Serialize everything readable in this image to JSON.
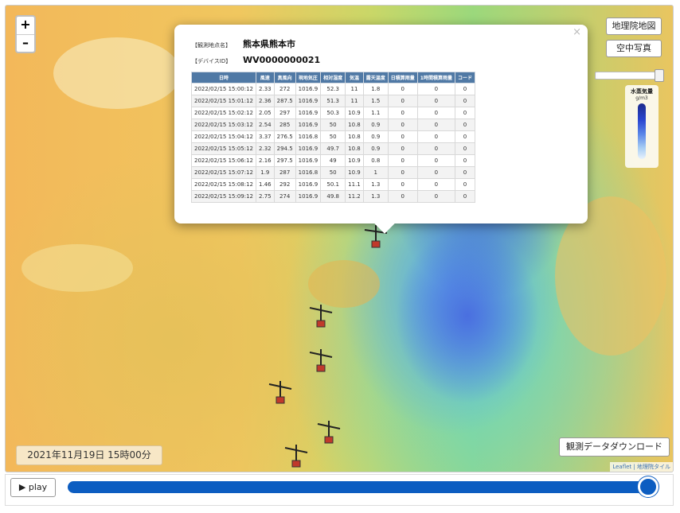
{
  "map": {
    "zoom_in": "+",
    "zoom_out": "–",
    "layer_buttons": {
      "gsi_map": "地理院地図",
      "aerial": "空中写真"
    },
    "legend": {
      "title": "水蒸気量",
      "unit": "g/m3"
    },
    "time_display": "2021年11月19日 15時00分",
    "download_label": "観測データダウンロード",
    "attribution": "Leaflet | 地理院タイル"
  },
  "popup": {
    "close": "×",
    "location_label": "【観測地点名】",
    "location_value": "熊本県熊本市",
    "device_label": "【デバイスID】",
    "device_value": "WV0000000021",
    "headers": [
      "日時",
      "風速",
      "真風向",
      "現地気圧",
      "相対湿度",
      "気温",
      "露天温度",
      "日積算雨量",
      "1時間積算雨量",
      "コード"
    ],
    "rows": [
      [
        "2022/02/15 15:00:12",
        "2.33",
        "272",
        "1016.9",
        "52.3",
        "11",
        "1.8",
        "0",
        "0",
        "0"
      ],
      [
        "2022/02/15 15:01:12",
        "2.36",
        "287.5",
        "1016.9",
        "51.3",
        "11",
        "1.5",
        "0",
        "0",
        "0"
      ],
      [
        "2022/02/15 15:02:12",
        "2.05",
        "297",
        "1016.9",
        "50.3",
        "10.9",
        "1.1",
        "0",
        "0",
        "0"
      ],
      [
        "2022/02/15 15:03:12",
        "2.54",
        "285",
        "1016.9",
        "50",
        "10.8",
        "0.9",
        "0",
        "0",
        "0"
      ],
      [
        "2022/02/15 15:04:12",
        "3.37",
        "276.5",
        "1016.8",
        "50",
        "10.8",
        "0.9",
        "0",
        "0",
        "0"
      ],
      [
        "2022/02/15 15:05:12",
        "2.32",
        "294.5",
        "1016.9",
        "49.7",
        "10.8",
        "0.9",
        "0",
        "0",
        "0"
      ],
      [
        "2022/02/15 15:06:12",
        "2.16",
        "297.5",
        "1016.9",
        "49",
        "10.9",
        "0.8",
        "0",
        "0",
        "0"
      ],
      [
        "2022/02/15 15:07:12",
        "1.9",
        "287",
        "1016.8",
        "50",
        "10.9",
        "1",
        "0",
        "0",
        "0"
      ],
      [
        "2022/02/15 15:08:12",
        "1.46",
        "292",
        "1016.9",
        "50.1",
        "11.1",
        "1.3",
        "0",
        "0",
        "0"
      ],
      [
        "2022/02/15 15:09:12",
        "2.75",
        "274",
        "1016.9",
        "49.8",
        "11.2",
        "1.3",
        "0",
        "0",
        "0"
      ]
    ]
  },
  "controls": {
    "play_label": "▶ play",
    "timeline_progress": 1.0
  }
}
